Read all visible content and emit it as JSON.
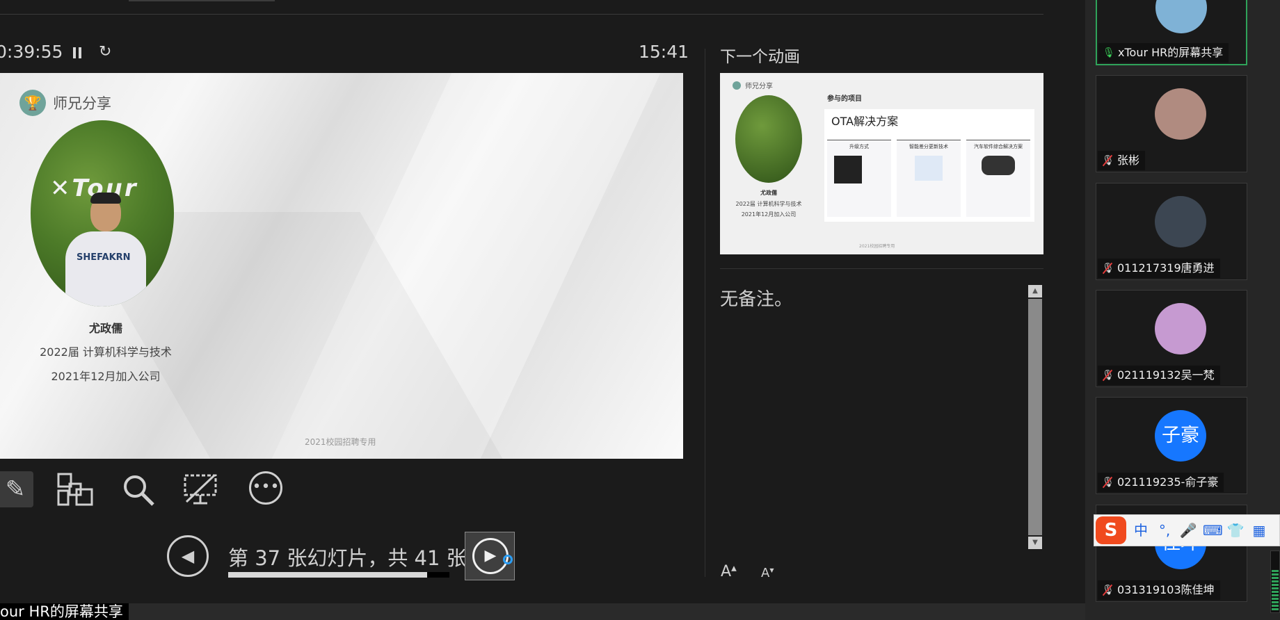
{
  "presenter": {
    "elapsed": "0:39:55",
    "clock": "15:41",
    "next_title": "下一个动画",
    "notes": "无备注。",
    "slide_counter": "第 37 张幻灯片，共 41 张",
    "progress": 0.9
  },
  "current_slide": {
    "header": "师兄分享",
    "portrait_logo": "✕Tour",
    "shirt_text": "SHEFAKRN",
    "name": "尤政儒",
    "class": "2022届 计算机科学与技术",
    "join": "2021年12月加入公司",
    "footer": "2021校园招聘专用"
  },
  "next_slide": {
    "header": "师兄分享",
    "name": "尤政儒",
    "class": "2022届 计算机科学与技术",
    "join": "2021年12月加入公司",
    "project_title": "参与的项目",
    "card_title": "OTA解决方案",
    "columns": [
      "升级方式",
      "智能差分更新技术",
      "汽车软件综合解决方案"
    ],
    "footer": "2021校园招聘专用"
  },
  "toolbar": {
    "icons": [
      "pen-icon",
      "slides-grid-icon",
      "zoom-icon",
      "screen-black-icon",
      "more-options-icon"
    ]
  },
  "share_label": "our HR的屏幕共享",
  "participants": [
    {
      "name": "xTour HR的屏幕共享",
      "avatar_text": "",
      "mic": "on",
      "color": "#7fb2d6"
    },
    {
      "name": "张彬",
      "avatar_text": "",
      "mic": "muted",
      "color": "#b08b80"
    },
    {
      "name": "011217319唐勇进",
      "avatar_text": "",
      "mic": "muted",
      "color": "#3c4652"
    },
    {
      "name": "021119132吴一梵",
      "avatar_text": "",
      "mic": "muted",
      "color": "#c69ad1"
    },
    {
      "name": "021119235-俞子豪",
      "avatar_text": "子豪",
      "mic": "muted",
      "color": "#1677ff"
    },
    {
      "name": "031319103陈佳坤",
      "avatar_text": "佳坤",
      "mic": "muted",
      "color": "#1677ff"
    }
  ],
  "ime": {
    "logo": "S",
    "lang": "中",
    "punct": "°,",
    "mic": "🎤",
    "keyboard": "⌨",
    "skin": "👕",
    "grid": "▦"
  }
}
